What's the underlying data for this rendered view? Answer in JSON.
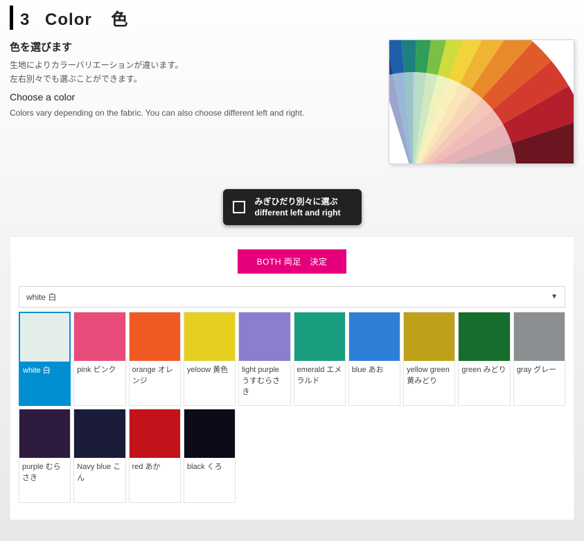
{
  "section": {
    "number": "3",
    "title_en": "Color",
    "title_jp": "色"
  },
  "info": {
    "heading_jp": "色を選びます",
    "line1_jp": "生地によりカラーバリエーションが違います。",
    "line2_jp": "左右別々でも選ぶことができます。",
    "heading_en": "Choose a color",
    "line_en": "Colors vary depending on the fabric. You can also choose different left and right."
  },
  "toggle": {
    "line1": "みぎひだり別々に選ぶ",
    "line2": "different left and right"
  },
  "confirm_label": "BOTH 両足　決定",
  "dropdown": {
    "selected": "white 白"
  },
  "swatches": [
    {
      "label": "white 白",
      "color": "#e3eee9",
      "selected": true
    },
    {
      "label": "pink ピンク",
      "color": "#e84c7a"
    },
    {
      "label": "orange オレンジ",
      "color": "#ef5a22"
    },
    {
      "label": "yeloow 黄色",
      "color": "#e6cf1f"
    },
    {
      "label": "light purple うすむらさき",
      "color": "#8a7ed1"
    },
    {
      "label": "emerald エメラルド",
      "color": "#1a9e80"
    },
    {
      "label": "blue あお",
      "color": "#2f7fd9"
    },
    {
      "label": "yellow green 黄みどり",
      "color": "#bfa019"
    },
    {
      "label": "green みどり",
      "color": "#156e2b"
    },
    {
      "label": "gray グレー",
      "color": "#8b8f91"
    },
    {
      "label": "purple むらさき",
      "color": "#2f1b3f"
    },
    {
      "label": "Navy blue こん",
      "color": "#1a1c3a"
    },
    {
      "label": "red あか",
      "color": "#c4121a"
    },
    {
      "label": "black くろ",
      "color": "#0e0b18"
    }
  ]
}
